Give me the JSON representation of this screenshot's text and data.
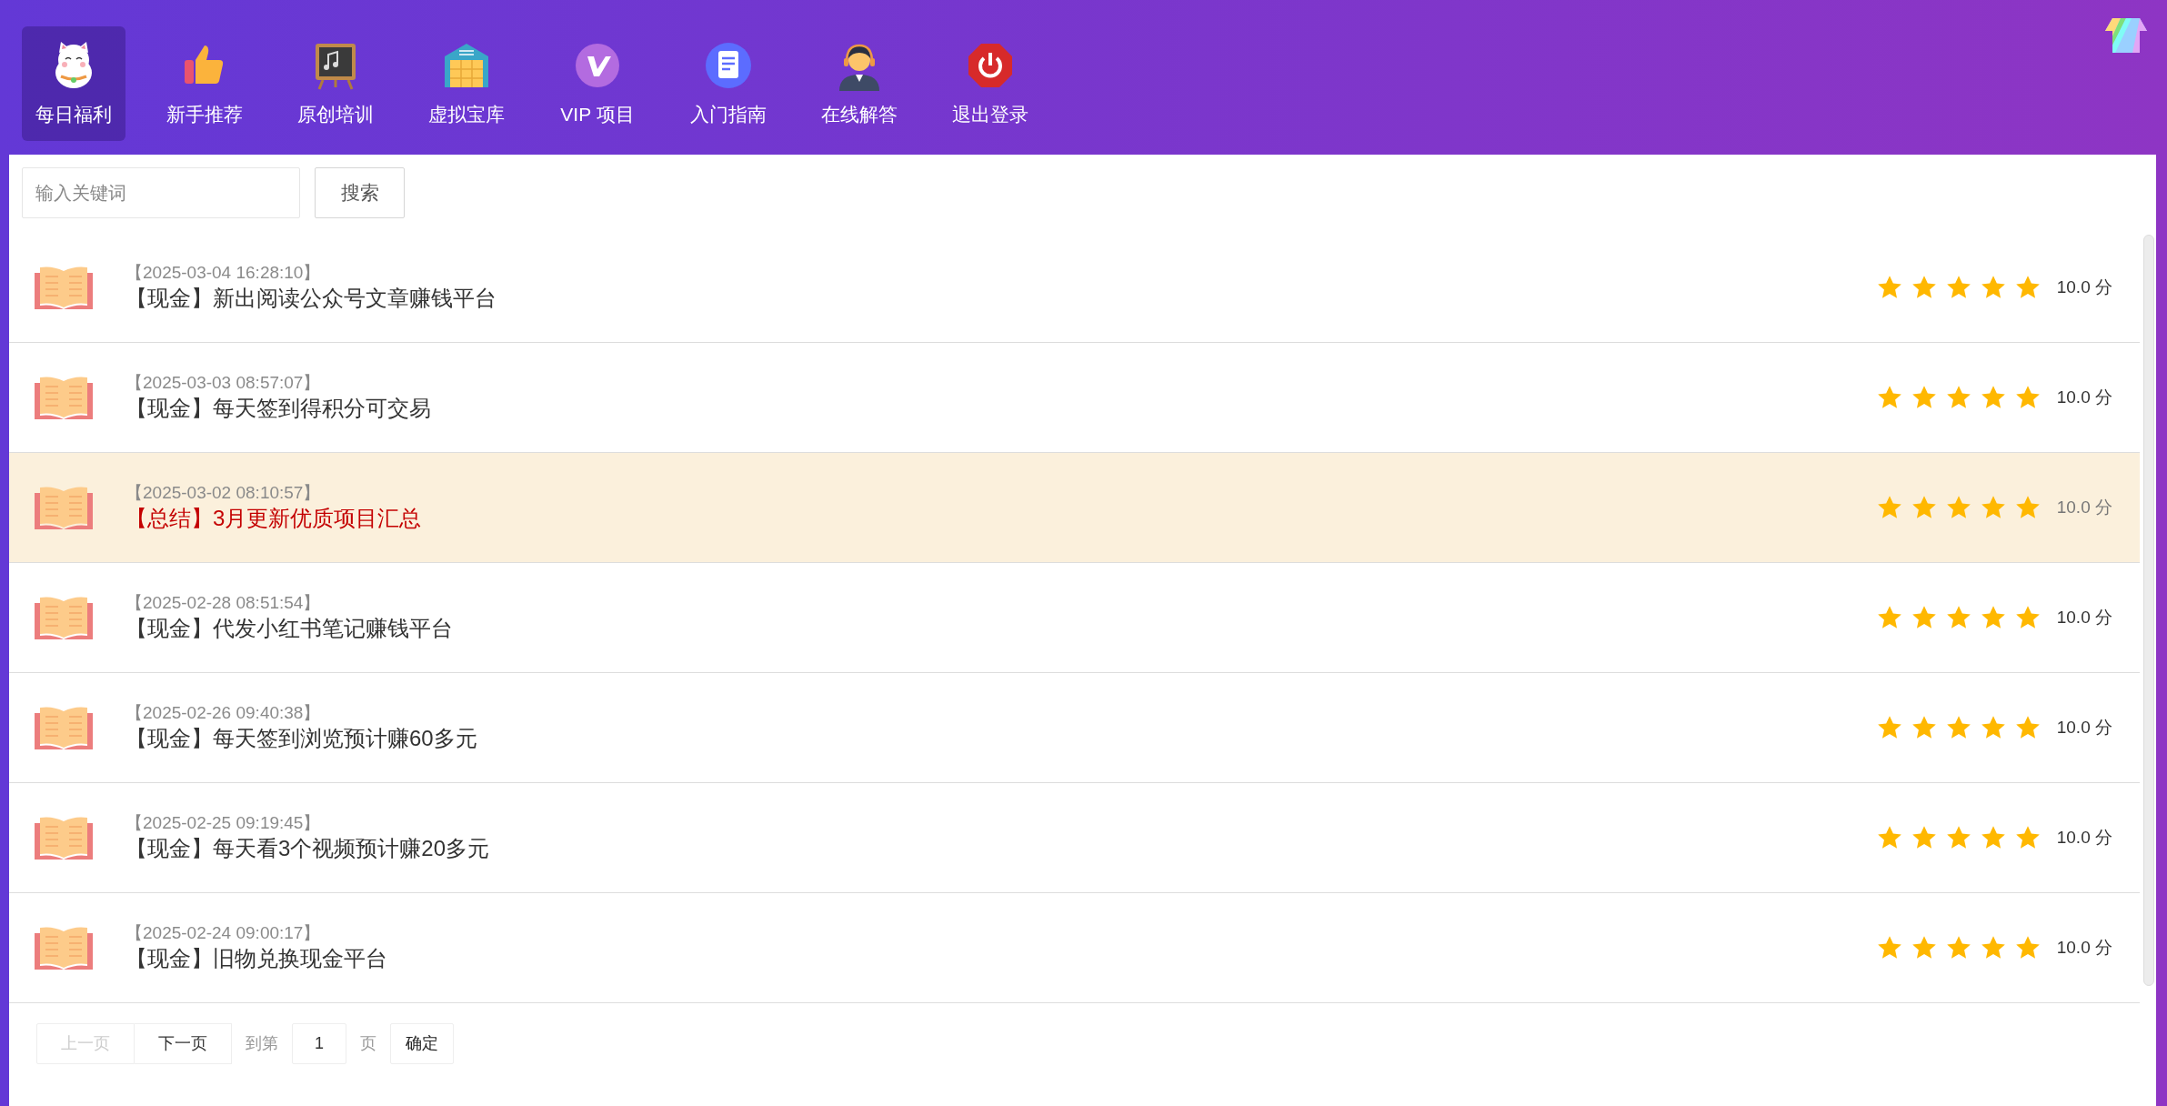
{
  "nav": [
    {
      "label": "每日福利",
      "selected": true
    },
    {
      "label": "新手推荐",
      "selected": false
    },
    {
      "label": "原创培训",
      "selected": false
    },
    {
      "label": "虚拟宝库",
      "selected": false
    },
    {
      "label": "VIP 项目",
      "selected": false
    },
    {
      "label": "入门指南",
      "selected": false
    },
    {
      "label": "在线解答",
      "selected": false
    },
    {
      "label": "退出登录",
      "selected": false
    }
  ],
  "search": {
    "placeholder": "输入关键词",
    "button": "搜索"
  },
  "items": [
    {
      "time": "【2025-03-04 16:28:10】",
      "title": "【现金】新出阅读公众号文章赚钱平台",
      "highlighted": false,
      "stars": 5,
      "score": "10.0 分"
    },
    {
      "time": "【2025-03-03 08:57:07】",
      "title": "【现金】每天签到得积分可交易",
      "highlighted": false,
      "stars": 5,
      "score": "10.0 分"
    },
    {
      "time": "【2025-03-02 08:10:57】",
      "title": "【总结】3月更新优质项目汇总",
      "highlighted": true,
      "stars": 5,
      "score": "10.0 分"
    },
    {
      "time": "【2025-02-28 08:51:54】",
      "title": "【现金】代发小红书笔记赚钱平台",
      "highlighted": false,
      "stars": 5,
      "score": "10.0 分"
    },
    {
      "time": "【2025-02-26 09:40:38】",
      "title": "【现金】每天签到浏览预计赚60多元",
      "highlighted": false,
      "stars": 5,
      "score": "10.0 分"
    },
    {
      "time": "【2025-02-25 09:19:45】",
      "title": "【现金】每天看3个视频预计赚20多元",
      "highlighted": false,
      "stars": 5,
      "score": "10.0 分"
    },
    {
      "time": "【2025-02-24 09:00:17】",
      "title": "【现金】旧物兑换现金平台",
      "highlighted": false,
      "stars": 5,
      "score": "10.0 分"
    }
  ],
  "pagination": {
    "prev": {
      "label": "上一页",
      "disabled": true
    },
    "next": {
      "label": "下一页",
      "disabled": false
    },
    "goto_label": "到第",
    "page_value": "1",
    "page_suffix": "页",
    "confirm": "确定"
  }
}
